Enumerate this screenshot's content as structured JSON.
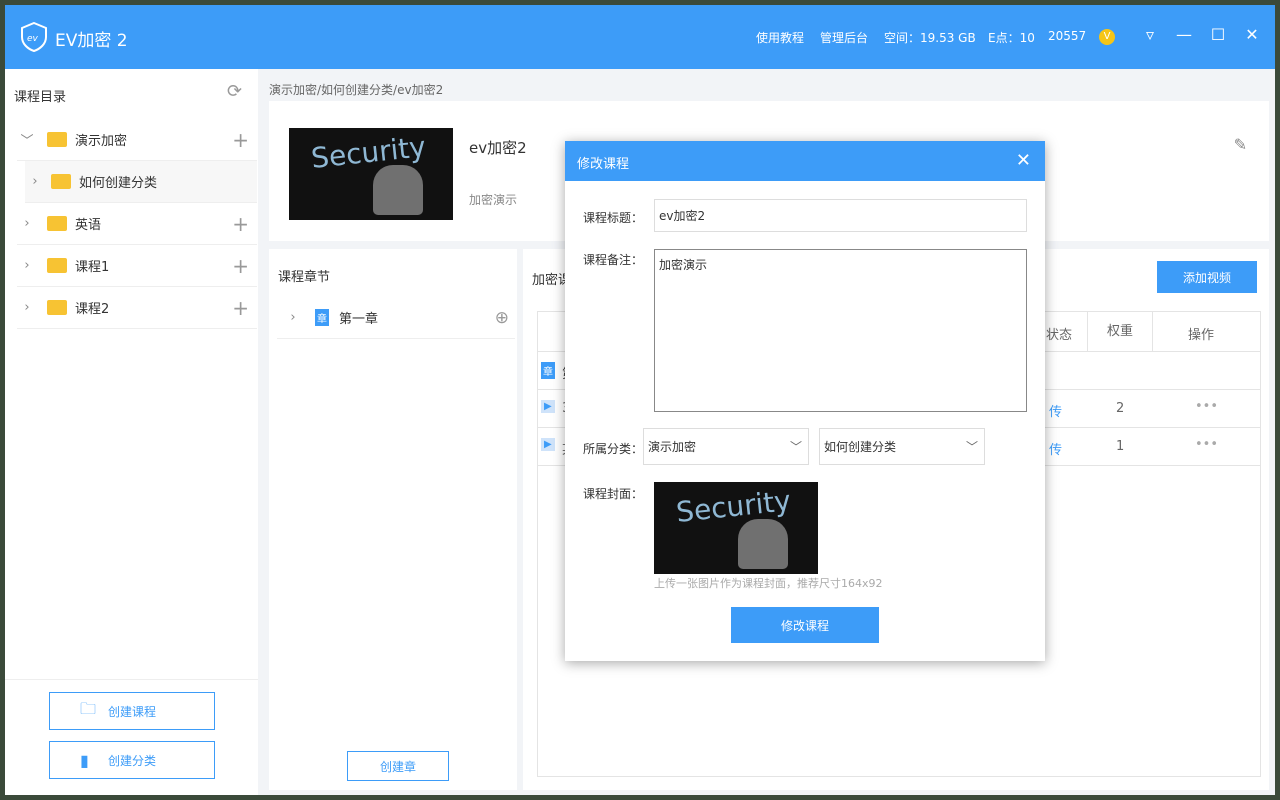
{
  "app": {
    "title": "EV加密 2",
    "links": [
      "使用教程",
      "管理后台"
    ],
    "space": "空间：19.53 GB",
    "epoints": "E点：10",
    "uid": "20557",
    "coin_icon": "V"
  },
  "sidebar": {
    "title": "课程目录",
    "items": [
      {
        "label": "演示加密",
        "expanded": true
      },
      {
        "label": "如何创建分类",
        "child": true
      },
      {
        "label": "英语"
      },
      {
        "label": "课程1"
      },
      {
        "label": "课程2"
      }
    ],
    "create_course": "创建课程",
    "create_category": "创建分类"
  },
  "breadcrumb": "演示加密/如何创建分类/ev加密2",
  "course": {
    "title": "ev加密2",
    "note": "加密演示",
    "cover_text": "Security"
  },
  "chapters": {
    "title": "课程章节",
    "items": [
      {
        "badge": "章",
        "label": "第一章"
      }
    ],
    "create": "创建章"
  },
  "main": {
    "title_partial": "加密课",
    "add_video": "添加视频",
    "columns": [
      "状态",
      "权重",
      "操作"
    ],
    "rows": [
      {
        "badge": "章",
        "name": "第",
        "status": "",
        "weight": "",
        "ops": ""
      },
      {
        "badge": "▶",
        "name": "3",
        "status": "传",
        "weight": "2",
        "ops": "•••"
      },
      {
        "badge": "▶",
        "name": "某",
        "status": "传",
        "weight": "1",
        "ops": "•••"
      }
    ]
  },
  "modal": {
    "title": "修改课程",
    "title_label": "课程标题：",
    "title_value": "ev加密2",
    "note_label": "课程备注：",
    "note_value": "加密演示",
    "category_label": "所属分类：",
    "category1": "演示加密",
    "category2": "如何创建分类",
    "cover_label": "课程封面：",
    "cover_hint": "上传一张图片作为课程封面，推荐尺寸164x92",
    "submit": "修改课程"
  }
}
